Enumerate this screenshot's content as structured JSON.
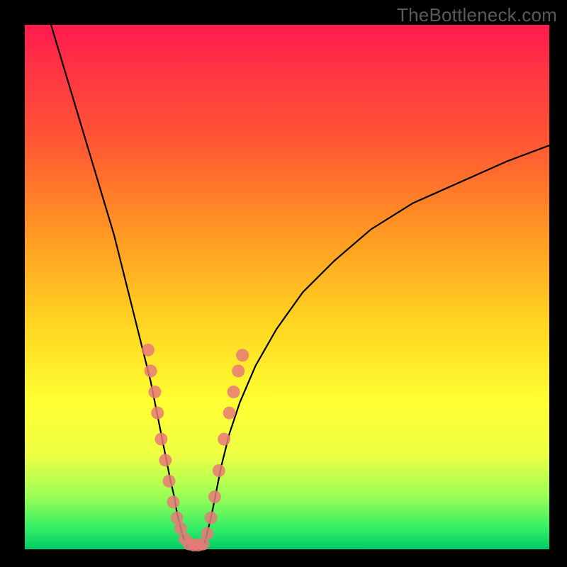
{
  "watermark": "TheBottleneck.com",
  "chart_data": {
    "type": "line",
    "title": "",
    "xlabel": "",
    "ylabel": "",
    "xlim": [
      0,
      100
    ],
    "ylim": [
      0,
      100
    ],
    "curve_left": {
      "x": [
        5,
        8,
        11,
        14,
        17,
        19,
        21,
        22.5,
        24,
        25,
        26,
        27,
        27.8,
        28.5,
        29,
        29.5,
        30,
        30.5,
        31
      ],
      "y": [
        100,
        90,
        80,
        70,
        60,
        52,
        44,
        38,
        32,
        27,
        22,
        17,
        13,
        10,
        7,
        5,
        3,
        1.5,
        0.5
      ]
    },
    "curve_right": {
      "x": [
        34,
        34.5,
        35,
        35.7,
        36.5,
        37.5,
        39,
        41,
        44,
        48,
        53,
        59,
        66,
        74,
        83,
        92,
        100
      ],
      "y": [
        0.5,
        2,
        4,
        7,
        11,
        16,
        22,
        28,
        35,
        42,
        49,
        55,
        61,
        66,
        70,
        74,
        77
      ]
    },
    "flat": {
      "x": [
        31,
        34
      ],
      "y": [
        0.5,
        0.5
      ]
    },
    "data_points_left": [
      {
        "x": 23.5,
        "y": 38
      },
      {
        "x": 24.0,
        "y": 34
      },
      {
        "x": 24.8,
        "y": 30
      },
      {
        "x": 25.3,
        "y": 26
      },
      {
        "x": 26.0,
        "y": 21
      },
      {
        "x": 26.8,
        "y": 17
      },
      {
        "x": 27.5,
        "y": 13
      },
      {
        "x": 28.3,
        "y": 9
      },
      {
        "x": 29.0,
        "y": 6
      },
      {
        "x": 29.7,
        "y": 4
      },
      {
        "x": 30.5,
        "y": 2
      }
    ],
    "data_points_flat": [
      {
        "x": 31.3,
        "y": 1
      },
      {
        "x": 32.2,
        "y": 0.8
      },
      {
        "x": 33.1,
        "y": 0.8
      },
      {
        "x": 34.0,
        "y": 1
      }
    ],
    "data_points_right": [
      {
        "x": 34.8,
        "y": 3
      },
      {
        "x": 35.5,
        "y": 6
      },
      {
        "x": 36.2,
        "y": 10
      },
      {
        "x": 37.0,
        "y": 15
      },
      {
        "x": 38.0,
        "y": 21
      },
      {
        "x": 39.0,
        "y": 26
      },
      {
        "x": 39.8,
        "y": 30
      },
      {
        "x": 40.7,
        "y": 34
      },
      {
        "x": 41.5,
        "y": 37
      }
    ]
  }
}
